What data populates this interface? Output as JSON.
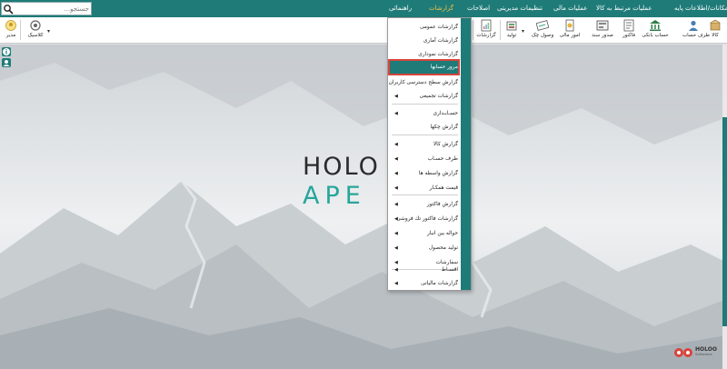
{
  "menubar": {
    "items": [
      {
        "label": "امکانات/اطلاعات پایه"
      },
      {
        "label": "عملیات مرتبط به کالا"
      },
      {
        "label": "عملیات مالی"
      },
      {
        "label": "تنظیمات مدیریتی"
      },
      {
        "label": "اصلاحات"
      },
      {
        "label": "گزارشات",
        "active": true
      },
      {
        "label": "راهنمائی"
      }
    ],
    "search_placeholder": "جستجو..."
  },
  "toolbar": {
    "buttons": [
      {
        "label": "کالا",
        "icon": "box-icon"
      },
      {
        "label": "طرف حساب",
        "icon": "person-icon"
      },
      {
        "label": "حساب بانکی",
        "icon": "bank-icon"
      },
      {
        "label": "فاکتور",
        "icon": "invoice-icon"
      },
      {
        "label": "صدور سند",
        "icon": "document-icon"
      },
      {
        "label": "امور مالی",
        "icon": "finance-icon"
      },
      {
        "label": "وصول چک",
        "icon": "check-icon"
      },
      {
        "label": "تولید",
        "icon": "production-icon"
      },
      {
        "label": "گزارشات",
        "icon": "report-icon"
      },
      {
        "label": "کلاسیک",
        "icon": "classic-icon"
      },
      {
        "label": "مدیر",
        "icon": "manager-icon"
      }
    ]
  },
  "reports_menu": {
    "items": [
      {
        "label": "گزارشات عمومی",
        "submenu": false
      },
      {
        "label": "گزارشات آماری",
        "submenu": false
      },
      {
        "label": "گزارشات نموداری",
        "submenu": false
      },
      {
        "label": "مرور حسابها",
        "submenu": false,
        "highlighted": true
      },
      {
        "label": "گزارش سطح دسترسی کاربران",
        "submenu": false
      },
      {
        "label": "گزارشات تجمیعی",
        "submenu": true
      },
      {
        "label": "حسـابـداری",
        "submenu": true
      },
      {
        "label": "گزارش چکها",
        "submenu": false
      },
      {
        "label": "گزارش کالا",
        "submenu": true
      },
      {
        "label": "طرف حسـاب",
        "submenu": true
      },
      {
        "label": "گزارش واسطه ها",
        "submenu": true
      },
      {
        "label": "قیمت همکـار",
        "submenu": true
      },
      {
        "label": "گزارش فاکتور",
        "submenu": true
      },
      {
        "label": "گزارشات فاکتور تك فروشی",
        "submenu": true
      },
      {
        "label": "حواله بین انبار",
        "submenu": true
      },
      {
        "label": "تولید محصول",
        "submenu": true
      },
      {
        "label": "سفارشات",
        "submenu": true
      },
      {
        "label": "اقسـاط",
        "submenu": true
      },
      {
        "label": "گزارشات مالیاتی",
        "submenu": true
      }
    ]
  },
  "splash": {
    "logo_line1": "HOLO",
    "logo_line2": "APE"
  },
  "brand": {
    "name": "HOLOO",
    "sub": "Softwares"
  },
  "colors": {
    "primary": "#1e7b78",
    "active_menu": "#f3c24a",
    "highlight_border": "#d9443c",
    "logo_accent": "#26a69a"
  }
}
